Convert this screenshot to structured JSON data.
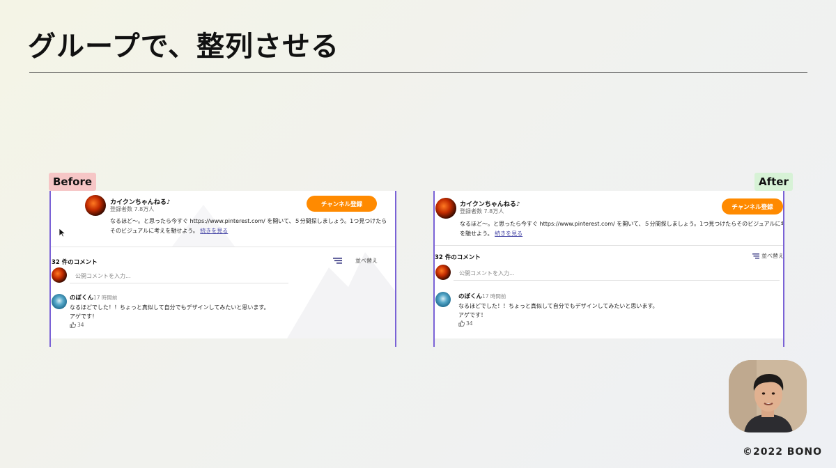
{
  "slide": {
    "title": "グループで、整列させる",
    "copyright": "©2022 BONO"
  },
  "labels": {
    "before": "Before",
    "after": "After"
  },
  "video": {
    "channel_name": "カイクンちゃんねる♪",
    "subscribers": "登録者数 7.8万人",
    "subscribe_label": "チャンネル登録",
    "description_line1": "なるほど〜。と思ったら今すぐ https://www.pinterest.com/ を開いて、５分間探しましょう。1つ見つけたら",
    "description_line2": "そのビジュアルに考えを馳せよう。",
    "description_after_line1": "なるほど〜。と思ったら今すぐ https://www.pinterest.com/ を開いて、５分間探しましょう。1つ見つけたらそのビジュアルに考え",
    "description_after_line2": "を馳せよう。",
    "more_link": "続きを見る"
  },
  "comments": {
    "count_label": "32 件のコメント",
    "sort_label": "並べ替え",
    "input_placeholder": "公開コメントを入力...",
    "items": [
      {
        "author": "のぼくん",
        "time": "17 時間前",
        "line1": "なるほどでした！！ちょっと真似して自分でもデザインしてみたいと思います。",
        "line2": "アゲです！",
        "likes": "34"
      }
    ]
  },
  "colors": {
    "subscribe_button": "#ff8a00",
    "guide_line": "#7a62d6",
    "before_tag": "#f6c6c6",
    "after_tag": "#d7f2d6",
    "link": "#4a4aa8"
  }
}
